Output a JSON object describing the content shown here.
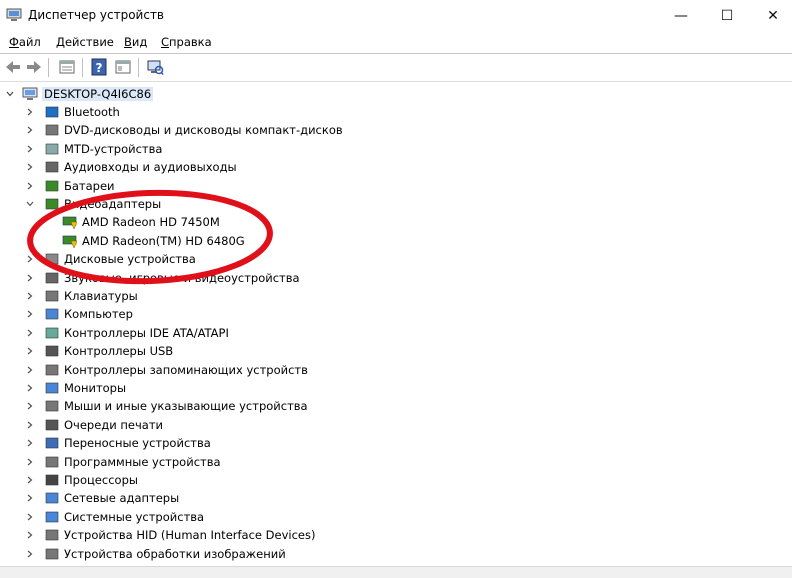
{
  "window": {
    "title": "Диспетчер устройств",
    "buttons": {
      "minimize": "—",
      "maximize": "☐",
      "close": "✕"
    }
  },
  "menu": [
    {
      "accel": "Ф",
      "rest": "айл"
    },
    {
      "accel": "Д",
      "rest": "ействие"
    },
    {
      "accel": "В",
      "rest": "ид"
    },
    {
      "accel": "С",
      "rest": "правка"
    }
  ],
  "toolbar": {
    "icons": [
      "back-arrow-icon",
      "forward-arrow-icon",
      "properties-icon",
      "help-icon",
      "view-icon",
      "scan-hardware-icon"
    ]
  },
  "tree": {
    "root": "DESKTOP-Q4I6C86",
    "categories": [
      {
        "label": "Bluetooth",
        "icon": "bluetooth-icon"
      },
      {
        "label": "DVD-дисководы и дисководы компакт-дисков",
        "icon": "dvd-drive-icon"
      },
      {
        "label": "MTD-устройства",
        "icon": "mtd-device-icon"
      },
      {
        "label": "Аудиовходы и аудиовыходы",
        "icon": "speaker-icon"
      },
      {
        "label": "Батареи",
        "icon": "battery-icon"
      },
      {
        "label": "Видеоадаптеры",
        "icon": "display-adapter-icon",
        "expanded": true,
        "children": [
          "AMD Radeon HD 7450M",
          "AMD Radeon(TM) HD 6480G"
        ]
      },
      {
        "label": "Дисковые устройства",
        "icon": "disk-drive-icon"
      },
      {
        "label": "Звуковые, игровые и видеоустройства",
        "icon": "sound-icon"
      },
      {
        "label": "Клавиатуры",
        "icon": "keyboard-icon"
      },
      {
        "label": "Компьютер",
        "icon": "computer-icon"
      },
      {
        "label": "Контроллеры IDE ATA/ATAPI",
        "icon": "ide-controller-icon"
      },
      {
        "label": "Контроллеры USB",
        "icon": "usb-icon"
      },
      {
        "label": "Контроллеры запоминающих устройств",
        "icon": "storage-controller-icon"
      },
      {
        "label": "Мониторы",
        "icon": "monitor-icon"
      },
      {
        "label": "Мыши и иные указывающие устройства",
        "icon": "mouse-icon"
      },
      {
        "label": "Очереди печати",
        "icon": "printer-icon"
      },
      {
        "label": "Переносные устройства",
        "icon": "portable-device-icon"
      },
      {
        "label": "Программные устройства",
        "icon": "software-device-icon"
      },
      {
        "label": "Процессоры",
        "icon": "processor-icon"
      },
      {
        "label": "Сетевые адаптеры",
        "icon": "network-adapter-icon"
      },
      {
        "label": "Системные устройства",
        "icon": "system-device-icon"
      },
      {
        "label": "Устройства HID (Human Interface Devices)",
        "icon": "hid-icon"
      },
      {
        "label": "Устройства обработки изображений",
        "icon": "imaging-device-icon"
      }
    ]
  },
  "colors": {
    "annotation_ellipse": "#e0101b",
    "icon_blue": "#1f6fc5",
    "gpu_green": "#3a8a2a"
  }
}
